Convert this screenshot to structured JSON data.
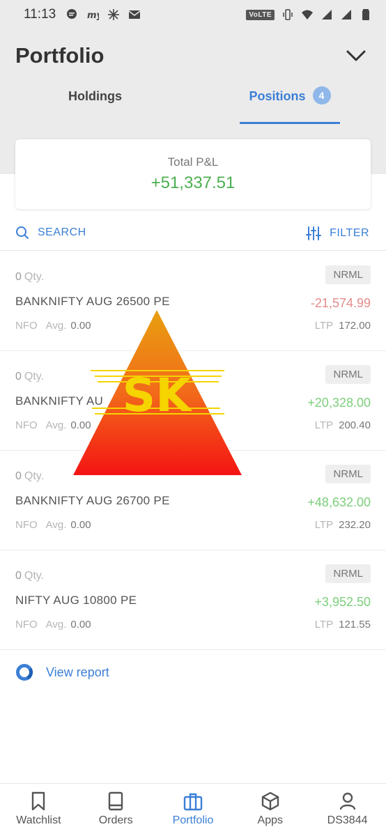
{
  "status_bar": {
    "time": "11:13",
    "left_icons": [
      "chat-bubble-icon",
      "my-app-icon",
      "sparkle-icon",
      "mail-icon"
    ],
    "volte": "VoLTE",
    "right_icons": [
      "vibrate-icon",
      "wifi-icon",
      "signal-icon",
      "signal-icon",
      "battery-icon"
    ]
  },
  "header": {
    "title": "Portfolio",
    "tabs": [
      {
        "label": "Holdings",
        "active": false
      },
      {
        "label": "Positions",
        "active": true,
        "badge": "4"
      }
    ]
  },
  "summary": {
    "label": "Total P&L",
    "value": "+51,337.51"
  },
  "toolbar": {
    "search_label": "SEARCH",
    "filter_label": "FILTER"
  },
  "positions": [
    {
      "qty": "0",
      "qty_label": "Qty.",
      "product": "NRML",
      "symbol": "BANKNIFTY AUG 26500 PE",
      "pnl": "-21,574.99",
      "pnl_sign": "neg",
      "exchange": "NFO",
      "avg_label": "Avg.",
      "avg": "0.00",
      "ltp_label": "LTP",
      "ltp": "172.00"
    },
    {
      "qty": "0",
      "qty_label": "Qty.",
      "product": "NRML",
      "symbol": "BANKNIFTY AU",
      "pnl": "+20,328.00",
      "pnl_sign": "pos",
      "exchange": "NFO",
      "avg_label": "Avg.",
      "avg": "0.00",
      "ltp_label": "LTP",
      "ltp": "200.40"
    },
    {
      "qty": "0",
      "qty_label": "Qty.",
      "product": "NRML",
      "symbol": "BANKNIFTY AUG 26700 PE",
      "pnl": "+48,632.00",
      "pnl_sign": "pos",
      "exchange": "NFO",
      "avg_label": "Avg.",
      "avg": "0.00",
      "ltp_label": "LTP",
      "ltp": "232.20"
    },
    {
      "qty": "0",
      "qty_label": "Qty.",
      "product": "NRML",
      "symbol": "NIFTY AUG 10800 PE",
      "pnl": "+3,952.50",
      "pnl_sign": "pos",
      "exchange": "NFO",
      "avg_label": "Avg.",
      "avg": "0.00",
      "ltp_label": "LTP",
      "ltp": "121.55"
    }
  ],
  "view_report_label": "View report",
  "watermark_text": "SK",
  "bottom_nav": [
    {
      "label": "Watchlist",
      "icon": "bookmark-icon",
      "active": false
    },
    {
      "label": "Orders",
      "icon": "book-icon",
      "active": false
    },
    {
      "label": "Portfolio",
      "icon": "briefcase-icon",
      "active": true
    },
    {
      "label": "Apps",
      "icon": "cube-icon",
      "active": false
    },
    {
      "label": "DS3844",
      "icon": "user-icon",
      "active": false
    }
  ],
  "colors": {
    "accent": "#3b7fd6",
    "profit": "#4caf50",
    "loss": "#e58b8b"
  }
}
